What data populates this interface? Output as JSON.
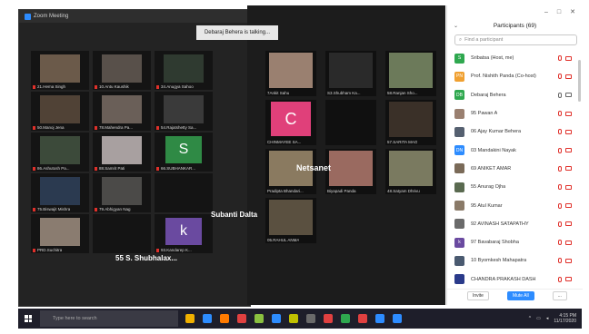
{
  "back_window": {
    "title": "Zoom Meeting",
    "tiles": [
      {
        "label": "21.Hema Singh",
        "bg": "#6b5a4a"
      },
      {
        "label": "10.Antu Kaushik",
        "bg": "#58504a"
      },
      {
        "label": "34.Anugya Sahoo",
        "bg": "#2f3a30"
      },
      {
        "label": "50.Manoj Jena",
        "bg": "#504236"
      },
      {
        "label": "78.Mahendra Pa...",
        "bg": "#6a5f58"
      },
      {
        "label": "54.Rajatshetty Sa...",
        "bg": "#3a3a3a"
      },
      {
        "label": "86.Ashutosh Pa...",
        "bg": "#3c4a3a"
      },
      {
        "label": "88.Samrit Pati",
        "bg": "#a8a0a0"
      },
      {
        "label": "66.SUBHANKAR...",
        "avatar": "S",
        "avatar_bg": "#2f8a45"
      },
      {
        "label": "75.Biswajit Mishra",
        "bg": "#2b3a50"
      },
      {
        "label": "79.Abhigyan Nag",
        "bg": "#4b4a48"
      },
      {
        "label": "",
        "bg": "#141414"
      },
      {
        "label": "PRD.Suchitra",
        "bg": "#8a7c70"
      },
      {
        "label": "",
        "bg": "#141414"
      },
      {
        "label": "93.Kandarep K...",
        "avatar": "k",
        "avatar_bg": "#6a4aa0"
      }
    ],
    "big_name": "55 S. Shubhalax..."
  },
  "front_window": {
    "banner": "Debaraj Behera is talking...",
    "tiles": [
      {
        "label": "7Ankit Sahu",
        "bg": "#9a8070"
      },
      {
        "label": "S3.Shubham Ka...",
        "bg": "#2a2a2a"
      },
      {
        "label": "58.Ranjan Sho...",
        "bg": "#6c7a5a"
      },
      {
        "label": "CHINMAYEE SA...",
        "avatar": "C",
        "avatar_bg": "#e0407a"
      },
      {
        "label": "",
        "bg": "#101010"
      },
      {
        "label": "57.SARITA MAO",
        "bg": "#3a3028"
      },
      {
        "label": "Pradipta Bhandari...",
        "bg": "#8a7a60"
      },
      {
        "label": "Biyapadi Panda",
        "bg": "#9a6a60"
      },
      {
        "label": "48.Satyam Dhrivu",
        "bg": "#7a7a60"
      },
      {
        "label": "05.RAHUL ANMA",
        "bg": "#5a5040"
      }
    ],
    "netsanet": "Netsanet",
    "subanti": "Subanti Dalta"
  },
  "participants": {
    "title": "Participants (69)",
    "search_placeholder": "Find a participant",
    "items": [
      {
        "initial": "S",
        "name": "Sribatsa (Host, me)",
        "avatar_bg": "#2fa84f",
        "mic": "off",
        "cam": "off"
      },
      {
        "initial": "PN",
        "name": "Prof. Nishith Panda (Co-host)",
        "avatar_bg": "#f0a030",
        "mic": "off",
        "cam": "off"
      },
      {
        "initial": "DB",
        "name": "Debaraj Behera",
        "avatar_bg": "#2fa84f",
        "mic": "on",
        "cam": "on"
      },
      {
        "initial": "",
        "name": "95 Pawan A",
        "avatar_bg": "#9a8070",
        "mic": "off",
        "cam": "off"
      },
      {
        "initial": "",
        "name": "06 Ajay Kumar Behera",
        "avatar_bg": "#556070",
        "mic": "off",
        "cam": "off"
      },
      {
        "initial": "DN",
        "name": "03 Mandakini Nayak",
        "avatar_bg": "#2d8cff",
        "mic": "off",
        "cam": "off"
      },
      {
        "initial": "",
        "name": "69 ANIKET AMAR",
        "avatar_bg": "#7a6a58",
        "mic": "off",
        "cam": "off"
      },
      {
        "initial": "",
        "name": "55 Anurag Ojha",
        "avatar_bg": "#5a6a50",
        "mic": "off",
        "cam": "off"
      },
      {
        "initial": "",
        "name": "95 Atul Kumar",
        "avatar_bg": "#8a7a68",
        "mic": "off",
        "cam": "off"
      },
      {
        "initial": "",
        "name": "92 AVINASH SATAPATHY",
        "avatar_bg": "#6a6a6a",
        "mic": "off",
        "cam": "off"
      },
      {
        "initial": "k",
        "name": "97 Bavabaraj Shobha",
        "avatar_bg": "#6a4aa0",
        "mic": "off",
        "cam": "off"
      },
      {
        "initial": "",
        "name": "10 Byomkesh Mahapatra",
        "avatar_bg": "#4a5a70",
        "mic": "off",
        "cam": "off"
      },
      {
        "initial": "",
        "name": "CHANDRA PRAKASH DASH",
        "avatar_bg": "#2a3a8a",
        "mic": "off",
        "cam": "off"
      }
    ],
    "invite_label": "Invite",
    "mute_all_label": "Mute All",
    "more_label": "..."
  },
  "taskbar": {
    "search_placeholder": "Type here to search",
    "time": "4:15 PM",
    "date": "11/17/2020",
    "icon_colors": [
      "#f0b000",
      "#2d8cff",
      "#ff7a00",
      "#e04040",
      "#8ac040",
      "#2d8cff",
      "#c0c000",
      "#6a6a6a",
      "#e04040",
      "#2fa84f",
      "#e04040",
      "#2d8cff",
      "#2d8cff"
    ]
  }
}
